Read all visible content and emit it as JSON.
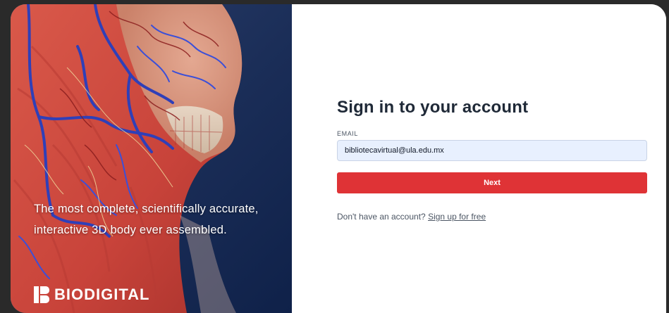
{
  "hero": {
    "tagline": "The most complete, scientifically accurate, interactive 3D body ever assembled.",
    "brand": "BIODIGITAL",
    "brand_icon": "biodigital-logo-icon"
  },
  "signin": {
    "title": "Sign in to your account",
    "email_label": "EMAIL",
    "email_value": "bibliotecavirtual@ula.edu.mx",
    "next_label": "Next",
    "no_account_text": "Don't have an account?",
    "signup_link": "Sign up for free"
  },
  "colors": {
    "accent_red": "#df3336",
    "hero_navy": "#1a2d57",
    "input_bg": "#e8f0fe",
    "title_text": "#1f2937"
  }
}
